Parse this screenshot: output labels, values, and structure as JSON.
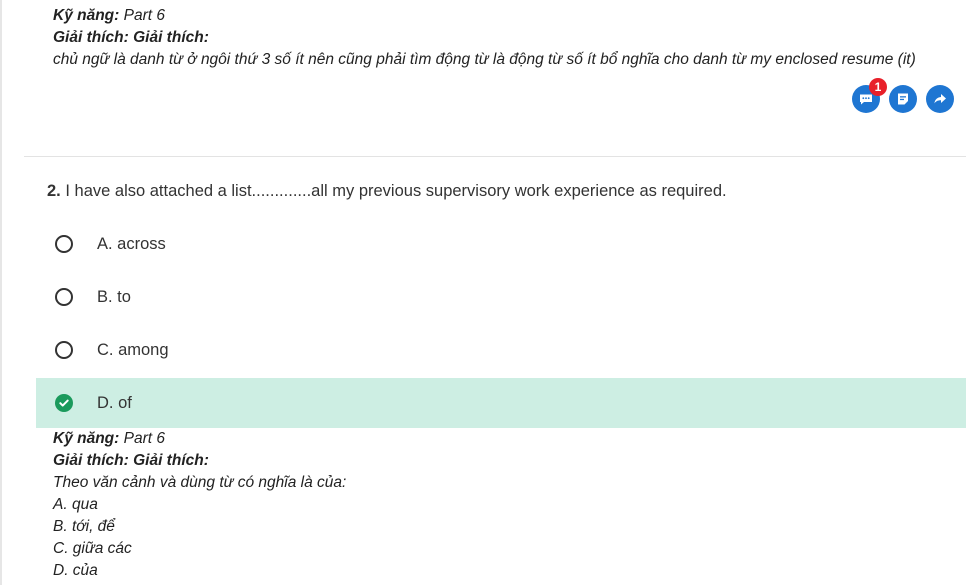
{
  "previous_explanation": {
    "skill_label": "Kỹ năng:",
    "skill_value": "Part 6",
    "explain_label": "Giải thích: Giải thích:",
    "text": "chủ ngữ là danh từ ở ngôi thứ 3 số ít nên cũng phải tìm động từ là động từ số ít bổ nghĩa cho danh từ my enclosed resume (it)"
  },
  "actions": {
    "comment_badge": "1",
    "comment_icon": "comment-icon",
    "note_icon": "note-icon",
    "share_icon": "share-icon",
    "accent_color": "#1f76d2",
    "badge_color": "#e8202a"
  },
  "question": {
    "number": "2.",
    "text": "I have also attached a list.............all my previous supervisory work experience as required.",
    "options": [
      {
        "label": "A. across",
        "correct": false
      },
      {
        "label": "B. to",
        "correct": false
      },
      {
        "label": "C. among",
        "correct": false
      },
      {
        "label": "D. of",
        "correct": true
      }
    ],
    "correct_bg_color": "#cdeee3",
    "correct_icon_color": "#1a9a5c"
  },
  "explanation": {
    "skill_label": "Kỹ năng:",
    "skill_value": "Part 6",
    "explain_label": "Giải thích: Giải thích:",
    "lines": [
      "Theo văn cảnh và dùng từ có nghĩa là của:",
      "A. qua",
      "B. tới, để",
      "C. giữa các",
      "D. của"
    ]
  }
}
